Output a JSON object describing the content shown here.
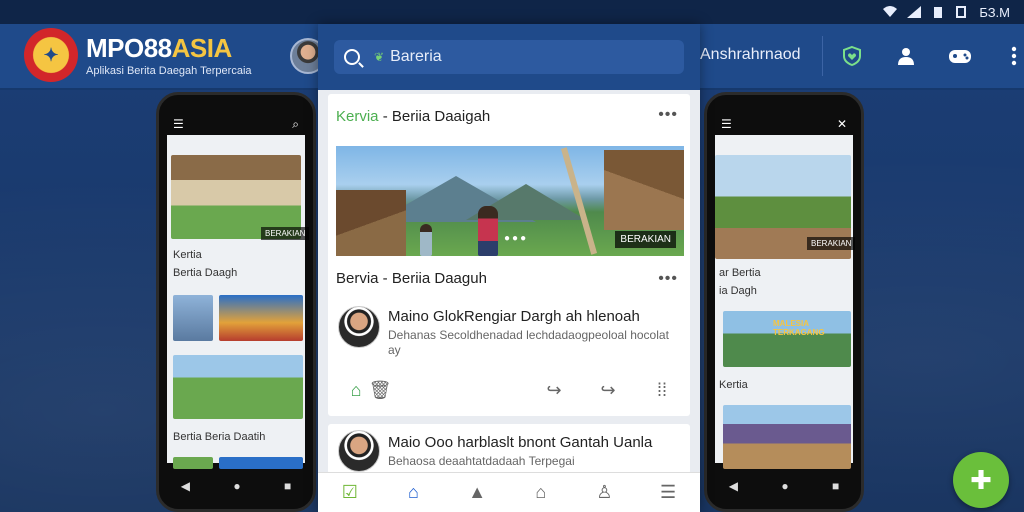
{
  "status_bar": {
    "time": "БЗ.М"
  },
  "app_bar": {
    "brand_main": "MPO88",
    "brand_accent": "ASIA",
    "tagline": "Aplikasi Berita Daegah Terpercaia",
    "username": "Anshrahrnaod",
    "icons": [
      "shield-heart-icon",
      "user-icon",
      "gamepad-icon",
      "more-vert-icon"
    ]
  },
  "search": {
    "placeholder": "Bareria"
  },
  "feed": {
    "card1": {
      "header_green": "Kervia",
      "header_rest": " - Beriia Daaigah",
      "image_badge": "BERAKIAN",
      "subtitle": "Bervia - Beriia Daaguh",
      "post_title": "Maino GlokRengiar Dargh ah hlenoah",
      "post_body": "Dehanas Secoldhenadad lechdadaogpeoloal hocolat ay"
    },
    "card2": {
      "post_title": "Maio Ooo harblaslt bnont Gantah Uanla",
      "post_body": "Behaosa deaahtatdadaah Terpegai"
    }
  },
  "left_phone": {
    "caption1": "Kertia",
    "caption2": "Bertia Daagh",
    "caption3": "Bertia Beria Daatih",
    "badge": "BERAKIAN"
  },
  "right_phone": {
    "caption1": "ar Bertia",
    "caption2": "ia Dagh",
    "caption3": "Kertia",
    "badge": "BERAKIAN",
    "panel_text": "MALESIA TERKAGANG"
  },
  "colors": {
    "appbar": "#1f4a8a",
    "accent_gold": "#f5c542",
    "green": "#4caf50",
    "fab": "#6abf3b",
    "active_nav": "#1f5fd1"
  }
}
